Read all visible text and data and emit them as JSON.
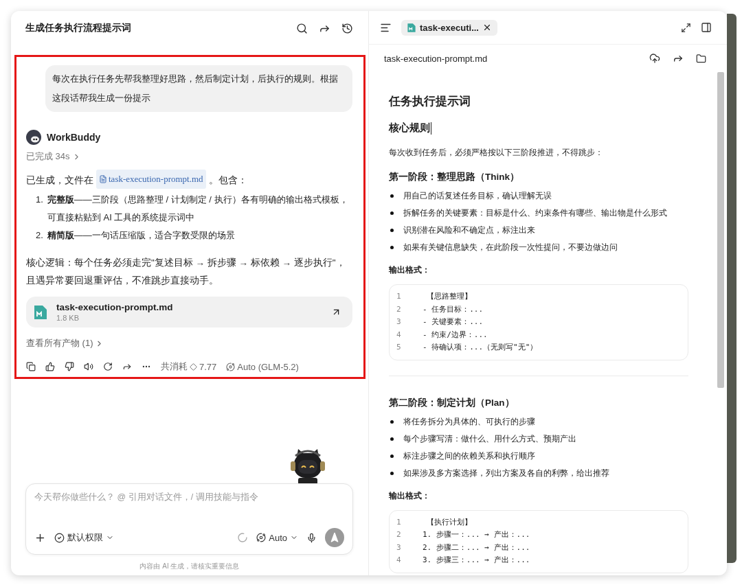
{
  "chat": {
    "title": "生成任务执行流程提示词",
    "user_message": "每次在执行任务先帮我整理好思路，然后制定计划，后执行的规则。根据这段话帮我生成一份提示",
    "assistant": {
      "name": "WorkBuddy",
      "status": "已完成 34s",
      "intro_before": "已生成，文件在",
      "intro_file": "task-execution-prompt.md",
      "intro_after": "。包含：",
      "list": [
        {
          "marker": "1.",
          "text": "**完整版**——三阶段（思路整理 / 计划制定 / 执行）各有明确的输出格式模板，可直接粘贴到 AI 工具的系统提示词中"
        },
        {
          "marker": "2.",
          "text": "**精简版**——一句话压缩版，适合字数受限的场景"
        }
      ],
      "summary": "核心逻辑：每个任务必须走完\"复述目标 → 拆步骤 → 标依赖 → 逐步执行\"，且遇异常要回退重评估，不准跳步直接动手。",
      "file_card": {
        "name": "task-execution-prompt.md",
        "size": "1.8 KB"
      },
      "view_all": "查看所有产物 (1)",
      "cost_label": "共消耗",
      "cost": "7.77",
      "model": "Auto (GLM-5.2)"
    },
    "input": {
      "placeholder": "今天帮你做些什么？ @ 引用对话文件，/ 调用技能与指令",
      "permission": "默认权限",
      "model": "Auto",
      "send_enabled": false
    },
    "disclaimer": "内容由 AI 生成，请核实重要信息"
  },
  "viewer": {
    "tabs": [
      {
        "label": "task-executi...",
        "selected": true
      }
    ],
    "file_name": "task-execution-prompt.md",
    "blocks": [
      {
        "kind": "h1",
        "text": "任务执行提示词"
      },
      {
        "kind": "h2",
        "text": "核心规则",
        "cursor": true
      },
      {
        "kind": "p",
        "text": "每次收到任务后，必须严格按以下三阶段推进，不得跳步："
      },
      {
        "kind": "h3",
        "text": "第一阶段：整理思路（Think）"
      },
      {
        "kind": "ul",
        "items": [
          "用自己的话复述任务目标，确认理解无误",
          "拆解任务的关键要素：目标是什么、约束条件有哪些、输出物是什么形式",
          "识别潜在风险和不确定点，标注出来",
          "如果有关键信息缺失，在此阶段一次性提问，不要边做边问"
        ]
      },
      {
        "kind": "label",
        "text": "输出格式："
      },
      {
        "kind": "code",
        "lines": [
          {
            "num": "1",
            "text": "【思路整理】"
          },
          {
            "num": "2",
            "text": "- 任务目标：..."
          },
          {
            "num": "3",
            "text": "- 关键要素：..."
          },
          {
            "num": "4",
            "text": "- 约束/边界：..."
          },
          {
            "num": "5",
            "text": "- 待确认项：...（无则写\"无\"）"
          }
        ]
      },
      {
        "kind": "divider"
      },
      {
        "kind": "h3",
        "text": "第二阶段：制定计划（Plan）"
      },
      {
        "kind": "ul",
        "items": [
          "将任务拆分为具体的、可执行的步骤",
          "每个步骤写清：做什么、用什么方式、预期产出",
          "标注步骤之间的依赖关系和执行顺序",
          "如果涉及多方案选择，列出方案及各自的利弊，给出推荐"
        ]
      },
      {
        "kind": "label",
        "text": "输出格式："
      },
      {
        "kind": "code",
        "lines": [
          {
            "num": "1",
            "text": "【执行计划】"
          },
          {
            "num": "2",
            "text": "1. 步骤一：... → 产出：..."
          },
          {
            "num": "3",
            "text": "2. 步骤二：... → 产出：..."
          },
          {
            "num": "4",
            "text": "3. 步骤三：... → 产出：..."
          }
        ]
      }
    ]
  }
}
